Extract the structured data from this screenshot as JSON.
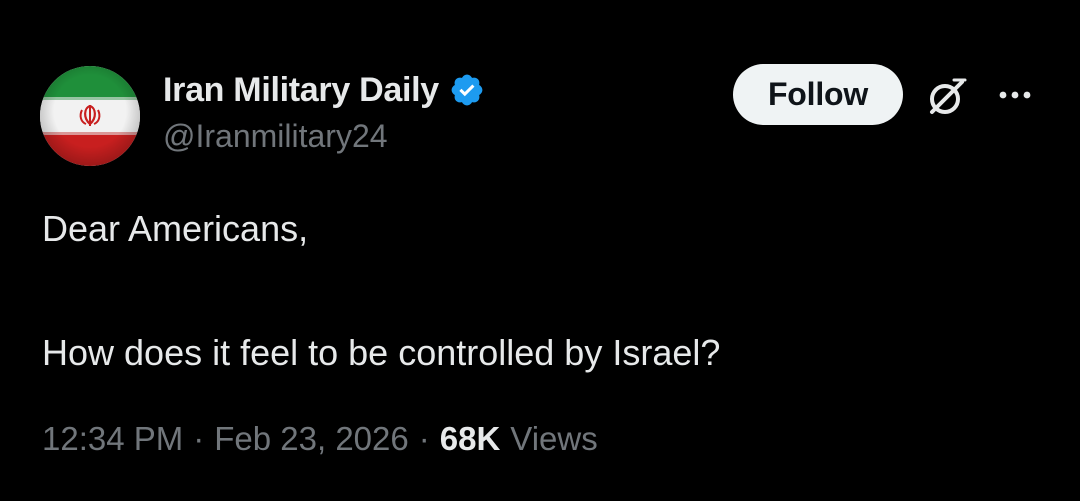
{
  "author": {
    "display_name": "Iran Military Daily",
    "handle": "@Iranmilitary24",
    "verified": true,
    "avatar": "iran-flag-avatar"
  },
  "actions": {
    "follow_label": "Follow",
    "grok_icon": "grok-icon",
    "more_icon": "more-dots-icon"
  },
  "tweet": {
    "lines": [
      "Dear Americans,",
      "How does it feel to be controlled by Israel?"
    ]
  },
  "meta": {
    "time": "12:34 PM",
    "separator": "·",
    "date": "Feb 23, 2026",
    "views_count": "68K",
    "views_label": "Views"
  },
  "colors": {
    "background": "#000000",
    "primary_text": "#e7e9ea",
    "secondary_text": "#71767b",
    "verified_blue": "#1d9bf0",
    "follow_bg": "#eff3f4",
    "flag_green": "#239f40",
    "flag_red": "#da0000"
  }
}
